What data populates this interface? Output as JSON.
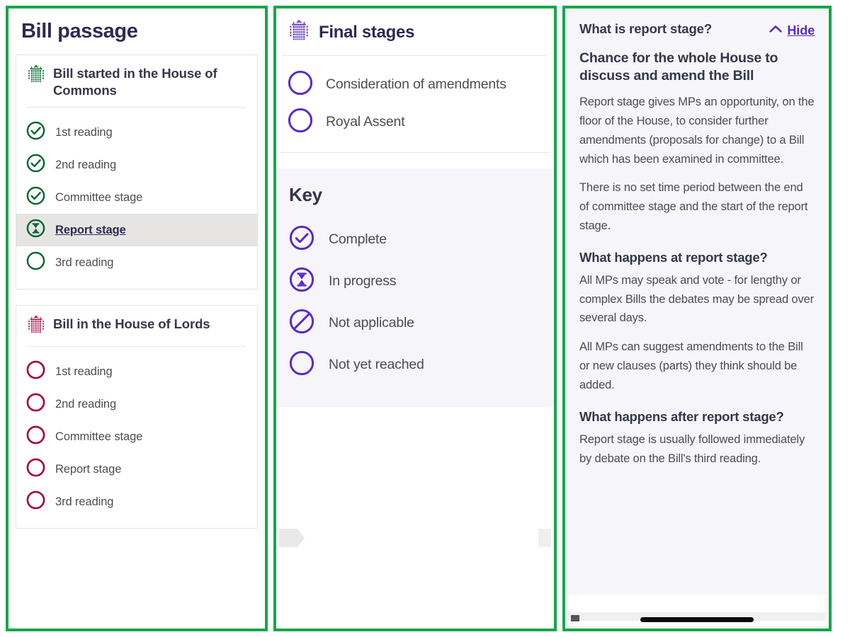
{
  "colors": {
    "frame_green": "#17a64a",
    "commons_green": "#00642c",
    "lords_red": "#a3003f",
    "purple": "#5b2bc4",
    "highlight_grey": "#e7e5e3",
    "panel_lavender": "#f5f5fa",
    "heading_navy": "#35374a",
    "body_grey": "#4d4d4d"
  },
  "panel_left": {
    "page_title": "Bill passage",
    "commons_card": {
      "icon": "portcullis-icon",
      "title": "Bill started in the House of Commons",
      "stages": [
        {
          "label": "1st reading",
          "status": "complete",
          "icon": "check-circle-icon"
        },
        {
          "label": "2nd reading",
          "status": "complete",
          "icon": "check-circle-icon"
        },
        {
          "label": "Committee stage",
          "status": "complete",
          "icon": "check-circle-icon"
        },
        {
          "label": "Report stage",
          "status": "in-progress",
          "icon": "hourglass-circle-icon",
          "current": true
        },
        {
          "label": "3rd reading",
          "status": "not-reached",
          "icon": "empty-circle-icon"
        }
      ]
    },
    "lords_card": {
      "icon": "portcullis-icon",
      "title": "Bill in the House of Lords",
      "stages": [
        {
          "label": "1st reading",
          "status": "not-reached",
          "icon": "empty-circle-icon"
        },
        {
          "label": "2nd reading",
          "status": "not-reached",
          "icon": "empty-circle-icon"
        },
        {
          "label": "Committee stage",
          "status": "not-reached",
          "icon": "empty-circle-icon"
        },
        {
          "label": "Report stage",
          "status": "not-reached",
          "icon": "empty-circle-icon"
        },
        {
          "label": "3rd reading",
          "status": "not-reached",
          "icon": "empty-circle-icon"
        }
      ]
    }
  },
  "panel_middle": {
    "icon": "portcullis-icon",
    "title": "Final stages",
    "stages": [
      {
        "label": "Consideration of amendments",
        "status": "not-reached",
        "icon": "empty-circle-icon"
      },
      {
        "label": "Royal Assent",
        "status": "not-reached",
        "icon": "empty-circle-icon"
      }
    ],
    "key": {
      "title": "Key",
      "items": [
        {
          "label": "Complete",
          "icon": "check-circle-icon"
        },
        {
          "label": "In progress",
          "icon": "hourglass-circle-icon"
        },
        {
          "label": "Not applicable",
          "icon": "no-entry-circle-icon"
        },
        {
          "label": "Not yet reached",
          "icon": "empty-circle-icon"
        }
      ]
    },
    "carousel": {
      "prev": "carousel-prev-arrow",
      "next": "carousel-next-arrow"
    }
  },
  "panel_right": {
    "question": "What is report stage?",
    "hide_label": "Hide",
    "hide_icon": "chevron-up-icon",
    "heading_1": "Chance for the whole House to discuss and amend the Bill",
    "para_1": "Report stage gives MPs an opportunity, on the floor of the House, to consider further amendments (proposals for change) to a Bill which has been examined in committee.",
    "para_2": "There is no set time period between the end of committee stage and the start of the report stage.",
    "heading_2": "What happens at report stage?",
    "para_3": "All MPs may speak and vote - for lengthy or complex Bills the debates may be spread over several days.",
    "para_4": "All MPs can suggest amendments to the Bill or new clauses (parts) they think should be added.",
    "heading_3": "What happens after report stage?",
    "para_5": "Report stage is usually followed immediately by debate on the Bill's third reading."
  }
}
